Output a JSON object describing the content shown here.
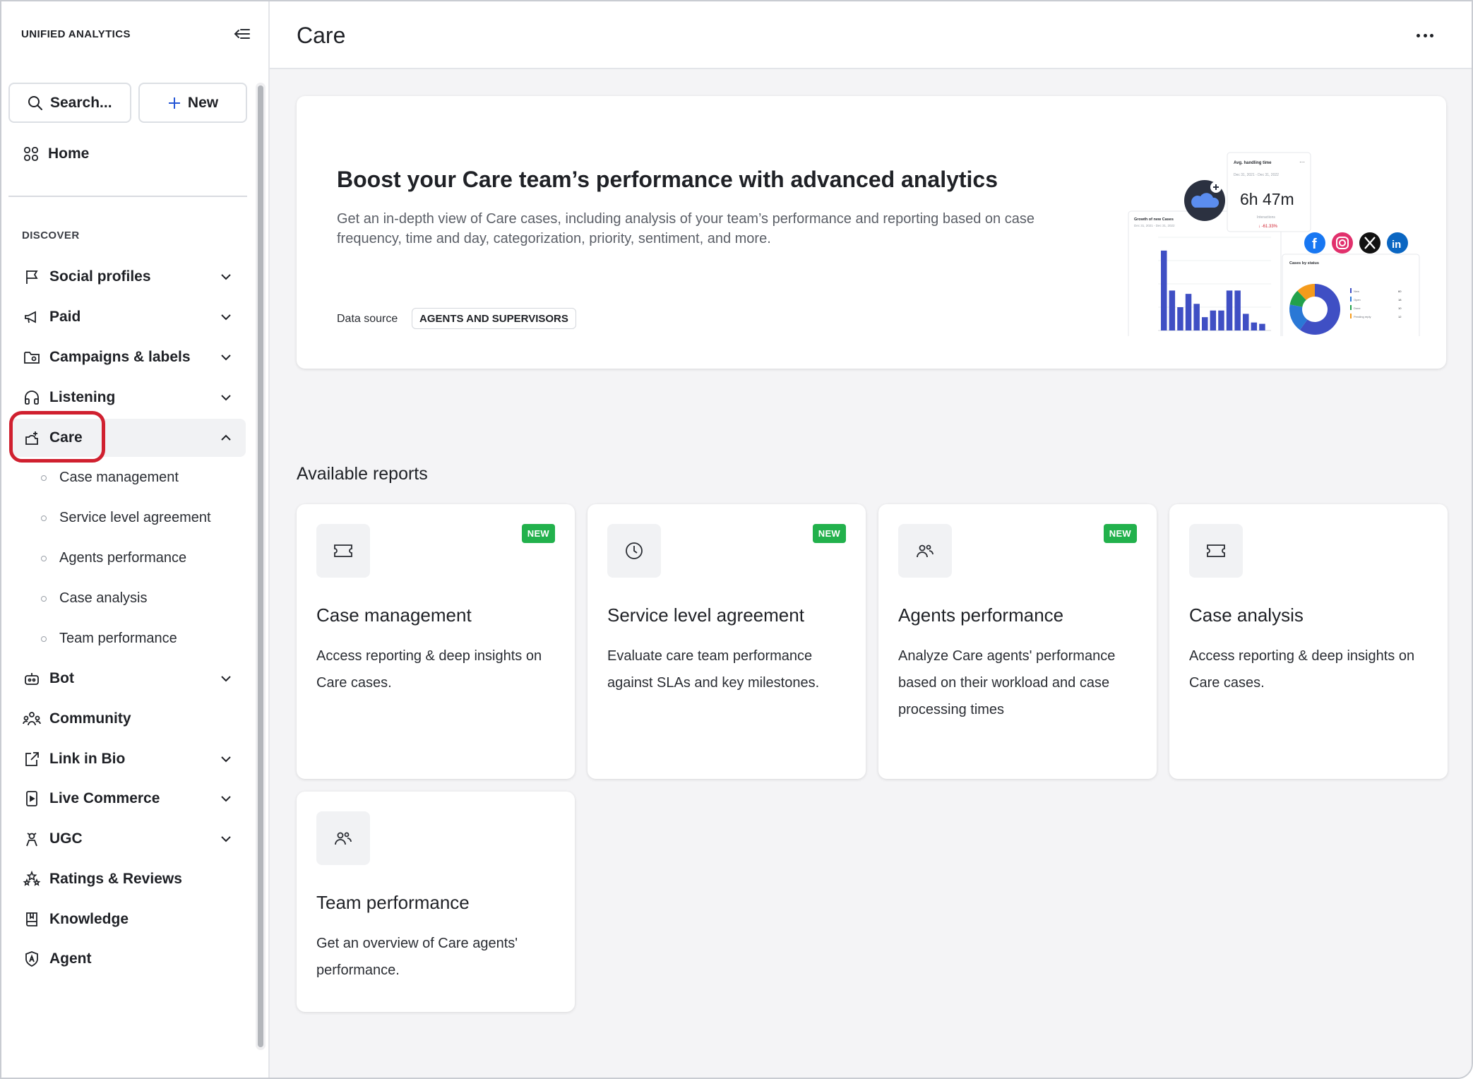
{
  "sidebar": {
    "brand": "UNIFIED ANALYTICS",
    "search_label": "Search...",
    "new_label": "New",
    "home_label": "Home",
    "section_label": "DISCOVER",
    "items": [
      {
        "label": "Social profiles",
        "icon": "flag-icon",
        "expandable": true
      },
      {
        "label": "Paid",
        "icon": "megaphone-icon",
        "expandable": true
      },
      {
        "label": "Campaigns & labels",
        "icon": "folder-icon",
        "expandable": true
      },
      {
        "label": "Listening",
        "icon": "headphones-icon",
        "expandable": true
      },
      {
        "label": "Care",
        "icon": "care-cloud-icon",
        "expandable": true,
        "expanded": true
      },
      {
        "label": "Bot",
        "icon": "bot-icon",
        "expandable": true
      },
      {
        "label": "Community",
        "icon": "community-icon",
        "expandable": false
      },
      {
        "label": "Link in Bio",
        "icon": "link-bio-icon",
        "expandable": true
      },
      {
        "label": "Live Commerce",
        "icon": "live-commerce-icon",
        "expandable": true
      },
      {
        "label": "UGC",
        "icon": "ugc-icon",
        "expandable": true
      },
      {
        "label": "Ratings & Reviews",
        "icon": "stars-icon",
        "expandable": false
      },
      {
        "label": "Knowledge",
        "icon": "book-icon",
        "expandable": false
      },
      {
        "label": "Agent",
        "icon": "agent-shield-icon",
        "expandable": false
      }
    ],
    "care_sub_items": [
      "Case management",
      "Service level agreement",
      "Agents performance",
      "Case analysis",
      "Team performance"
    ]
  },
  "header": {
    "title": "Care"
  },
  "banner": {
    "title": "Boost your Care team’s performance with advanced analytics",
    "description": "Get an in-depth view of Care cases, including analysis of your team’s performance and reporting based on case frequency, time and day, categorization, priority, sentiment, and more.",
    "data_source_label": "Data source",
    "data_source_value": "AGENTS AND SUPERVISORS",
    "illustration": {
      "handling_title": "Avg. handling time",
      "handling_dates": "Dec 31, 2021 - Dec 31, 2022",
      "handling_value": "6h 47m",
      "handling_sub": "Interactions",
      "handling_delta": "↓ -61.33%",
      "growth_title": "Growth of new Cases",
      "growth_dates": "Dec 31, 2021 - Dec 31, 2022",
      "growth_bars": [
        120,
        60,
        35,
        55,
        40,
        20,
        30,
        30,
        60,
        60,
        25,
        12,
        10
      ],
      "status_title": "Cases by status",
      "status_segments": [
        {
          "label": "New",
          "value": 60,
          "color": "#3f4fc4"
        },
        {
          "label": "Open",
          "value": 18,
          "color": "#2a78d6"
        },
        {
          "label": "Done",
          "value": 10,
          "color": "#22a14c"
        },
        {
          "label": "Pending reply",
          "value": 12,
          "color": "#f59b1c"
        }
      ]
    }
  },
  "reports": {
    "section_title": "Available reports",
    "badge_label": "NEW",
    "cards": [
      {
        "title": "Case management",
        "description": "Access reporting & deep insights on Care cases.",
        "icon": "ticket-icon",
        "is_new": true
      },
      {
        "title": "Service level agreement",
        "description": "Evaluate care team performance against SLAs and key milestones.",
        "icon": "clock-icon",
        "is_new": true
      },
      {
        "title": "Agents performance",
        "description": "Analyze Care agents' performance based on their workload and case processing times",
        "icon": "agents-icon",
        "is_new": true
      },
      {
        "title": "Case analysis",
        "description": "Access reporting & deep insights on Care cases.",
        "icon": "ticket-icon",
        "is_new": false
      },
      {
        "title": "Team performance",
        "description": "Get an overview of Care agents' performance.",
        "icon": "agents-icon",
        "is_new": false
      }
    ]
  }
}
